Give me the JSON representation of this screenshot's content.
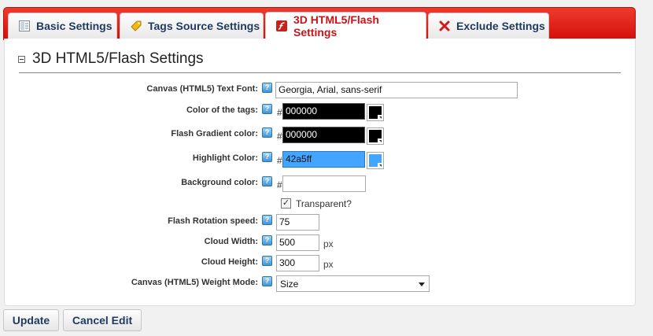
{
  "tabs": [
    {
      "label": "Basic Settings",
      "icon": "page-icon",
      "active": false
    },
    {
      "label": "Tags Source Settings",
      "icon": "tag-icon",
      "active": false
    },
    {
      "label": "3D HTML5/Flash Settings",
      "icon": "flash-icon",
      "active": true
    },
    {
      "label": "Exclude Settings",
      "icon": "exclude-x-icon",
      "active": false
    }
  ],
  "section": {
    "title": "3D HTML5/Flash Settings"
  },
  "help_glyph": "?",
  "hash": "#",
  "fields": {
    "font": {
      "label": "Canvas (HTML5) Text Font:",
      "value": "Georgia, Arial, sans-serif"
    },
    "tag_color": {
      "label": "Color of the tags:",
      "value": "000000",
      "swatch": "#000000"
    },
    "gradient_color": {
      "label": "Flash Gradient color:",
      "value": "000000",
      "swatch": "#000000"
    },
    "highlight_color": {
      "label": "Highlight Color:",
      "value": "42a5ff",
      "swatch": "#42a5ff"
    },
    "background_color": {
      "label": "Background color:",
      "value": ""
    },
    "transparent": {
      "label": "Transparent?",
      "checked": true,
      "mark": "✓"
    },
    "rotation_speed": {
      "label": "Flash Rotation speed:",
      "value": "75"
    },
    "cloud_width": {
      "label": "Cloud Width:",
      "value": "500",
      "unit": "px"
    },
    "cloud_height": {
      "label": "Cloud Height:",
      "value": "300",
      "unit": "px"
    },
    "weight_mode": {
      "label": "Canvas (HTML5) Weight Mode:",
      "value": "Size"
    }
  },
  "buttons": {
    "update": "Update",
    "cancel": "Cancel Edit"
  },
  "colors": {
    "accent": "#e2130e",
    "active_tab_text": "#c5141a",
    "tab_text": "#1e3a5f"
  }
}
